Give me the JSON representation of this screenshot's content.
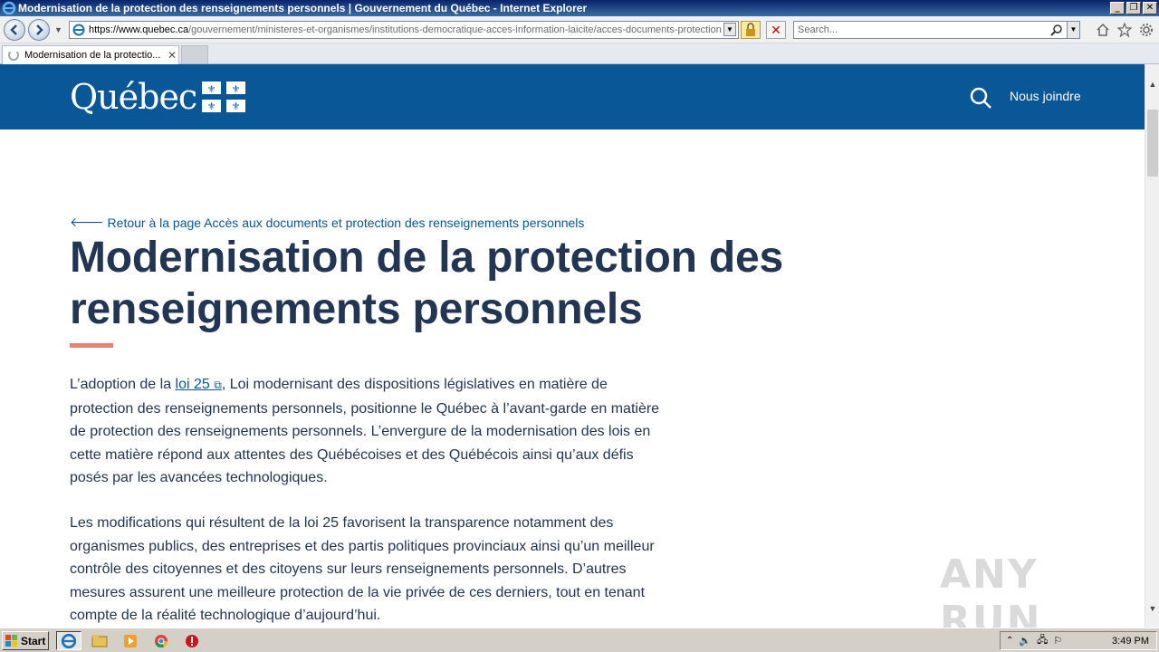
{
  "window": {
    "title": "Modernisation de la protection des renseignements personnels | Gouvernement du Québec - Internet Explorer",
    "controls": [
      "_",
      "❐",
      "✕"
    ]
  },
  "browser": {
    "url_host": "https://www.quebec.ca",
    "url_path": "/gouvernement/ministeres-et-organismes/institutions-democratique-acces-information-laicite/acces-documents-protection",
    "search_placeholder": "Search...",
    "tab_title": "Modernisation de la protectio..."
  },
  "site": {
    "logo_text": "Québec",
    "contact_label": "Nous joindre",
    "brand_color": "#095797"
  },
  "page": {
    "back_link": "Retour à la page Accès aux documents et protection des renseignements personnels",
    "title": "Modernisation de la protection des renseignements personnels",
    "para1_before": "L’adoption de la ",
    "para1_link": "loi 25",
    "para1_after": ", Loi modernisant des dispositions législatives en matière de protection des renseignements personnels, positionne le Québec à l’avant-garde en matière de protection des renseignements personnels. L’envergure de la modernisation des lois en cette matière répond aux attentes des Québécoises et des Québécois ainsi qu’aux défis posés par les avancées technologiques.",
    "para2": "Les modifications qui résultent de la loi 25 favorisent la transparence notamment des organismes publics, des entreprises et des partis politiques provinciaux ainsi qu’un meilleur contrôle des citoyennes et des citoyens sur leurs renseignements personnels. D’autres mesures assurent une meilleure protection de la vie privée de ces derniers, tout en tenant compte de la réalité technologique d’aujourd’hui."
  },
  "watermark": "ANY RUN",
  "taskbar": {
    "start_label": "Start",
    "clock": "3:49 PM"
  }
}
